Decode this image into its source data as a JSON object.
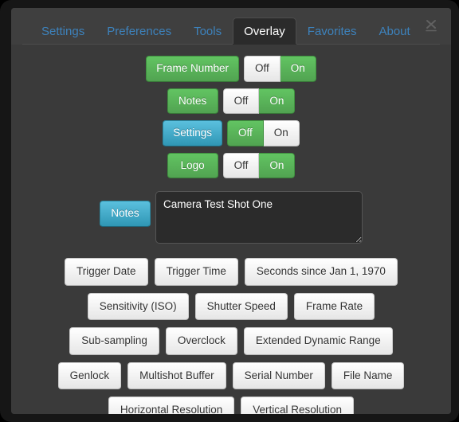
{
  "window": {
    "tabs": [
      {
        "label": "Settings",
        "active": false
      },
      {
        "label": "Preferences",
        "active": false
      },
      {
        "label": "Tools",
        "active": false
      },
      {
        "label": "Overlay",
        "active": true
      },
      {
        "label": "Favorites",
        "active": false
      },
      {
        "label": "About",
        "active": false
      }
    ],
    "collapse_icon": "close-collapse-icon"
  },
  "colors": {
    "accent_green": "#51a351",
    "accent_blue": "#2f96b4",
    "tab_link": "#3d82bc",
    "panel_bg": "#3a3a3a",
    "header_bg": "#3f3f3f",
    "active_tab_bg": "#2b2b2b",
    "frame_bg": "#161616",
    "button_default_bg": "#e6e6e6"
  },
  "overlay": {
    "toggle_rows": [
      {
        "name": "frame-number",
        "label": "Frame Number",
        "label_style": "green",
        "options": [
          {
            "label": "Off",
            "state": "inactive"
          },
          {
            "label": "On",
            "state": "active"
          }
        ]
      },
      {
        "name": "notes",
        "label": "Notes",
        "label_style": "green",
        "options": [
          {
            "label": "Off",
            "state": "inactive"
          },
          {
            "label": "On",
            "state": "active"
          }
        ]
      },
      {
        "name": "settings",
        "label": "Settings",
        "label_style": "blue",
        "options": [
          {
            "label": "Off",
            "state": "active"
          },
          {
            "label": "On",
            "state": "inactive"
          }
        ]
      },
      {
        "name": "logo",
        "label": "Logo",
        "label_style": "green",
        "options": [
          {
            "label": "Off",
            "state": "inactive"
          },
          {
            "label": "On",
            "state": "active"
          }
        ]
      }
    ],
    "notes_field": {
      "label": "Notes",
      "value": "Camera Test Shot One",
      "placeholder": ""
    },
    "field_rows": [
      {
        "buttons": [
          "Trigger Date",
          "Trigger Time",
          "Seconds since Jan 1, 1970"
        ]
      },
      {
        "buttons": [
          "Sensitivity (ISO)",
          "Shutter Speed",
          "Frame Rate"
        ]
      },
      {
        "buttons": [
          "Sub-sampling",
          "Overclock",
          "Extended Dynamic Range"
        ]
      },
      {
        "buttons": [
          "Genlock",
          "Multishot Buffer",
          "Serial Number",
          "File Name"
        ]
      },
      {
        "buttons": [
          "Horizontal Resolution",
          "Vertical Resolution"
        ]
      }
    ]
  }
}
